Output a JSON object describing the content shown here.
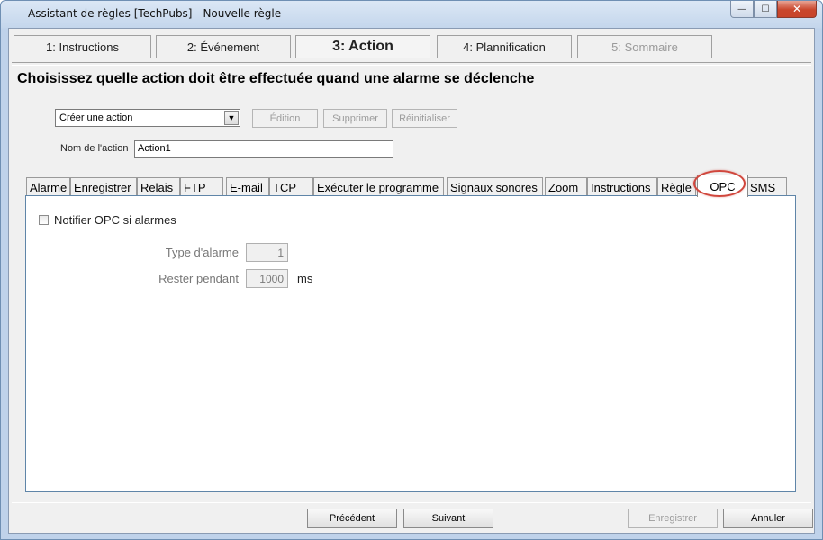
{
  "window": {
    "title": "Assistant de règles [TechPubs] - Nouvelle règle",
    "controls": {
      "minimize": "—",
      "maximize": "☐",
      "close": "✕"
    }
  },
  "steps": [
    {
      "label": "1: Instructions",
      "state": "normal"
    },
    {
      "label": "2: Événement",
      "state": "normal"
    },
    {
      "label": "3: Action",
      "state": "active"
    },
    {
      "label": "4: Plannification",
      "state": "normal"
    },
    {
      "label": "5: Sommaire",
      "state": "disabled"
    }
  ],
  "heading": "Choisissez quelle action doit être effectuée quand une alarme se déclenche",
  "action_select": {
    "value": "Créer une action",
    "arrow": "▼"
  },
  "action_buttons": {
    "edit": "Édition",
    "delete": "Supprimer",
    "reset": "Réinitialiser"
  },
  "action_name": {
    "label": "Nom de l'action",
    "value": "Action1"
  },
  "tabs": [
    {
      "label": "Alarme"
    },
    {
      "label": "Enregistrer"
    },
    {
      "label": "Relais"
    },
    {
      "label": "FTP"
    },
    {
      "label": "E-mail"
    },
    {
      "label": "TCP"
    },
    {
      "label": "Exécuter le programme"
    },
    {
      "label": "Signaux sonores"
    },
    {
      "label": "Zoom"
    },
    {
      "label": "Instructions"
    },
    {
      "label": "Règle"
    },
    {
      "label": "OPC"
    },
    {
      "label": "SMS"
    }
  ],
  "active_tab": "OPC",
  "highlight_color": "#d0463c",
  "opc_panel": {
    "notify_label": "Notifier OPC si alarmes",
    "notify_checked": false,
    "alarm_type_label": "Type d'alarme",
    "alarm_type_value": "1",
    "duration_label": "Rester pendant",
    "duration_value": "1000",
    "duration_unit": "ms"
  },
  "footer": {
    "previous": "Précédent",
    "next": "Suivant",
    "save": "Enregistrer",
    "cancel": "Annuler"
  }
}
